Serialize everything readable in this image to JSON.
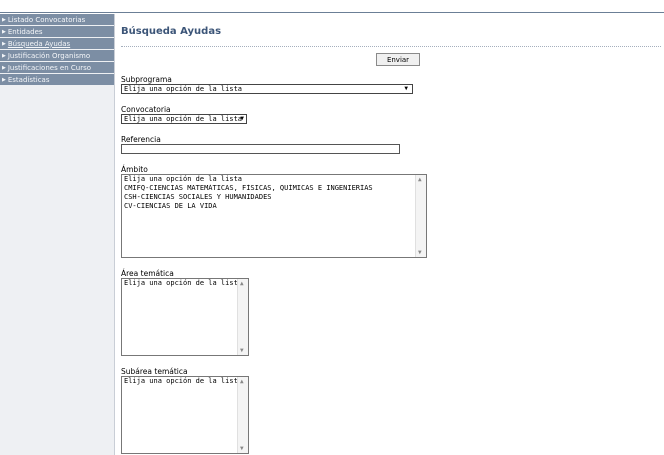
{
  "sidebar": {
    "items": [
      {
        "label": "Listado Convocatorias"
      },
      {
        "label": "Entidades"
      },
      {
        "label": "Búsqueda Ayudas"
      },
      {
        "label": "Justificación Organismo"
      },
      {
        "label": "Justificaciones en Curso"
      },
      {
        "label": "Estadísticas"
      }
    ]
  },
  "page": {
    "title": "Búsqueda Ayudas",
    "send_label": "Enviar"
  },
  "form": {
    "subprograma": {
      "label": "Subprograma",
      "value": "Elija una opción de la lista"
    },
    "convocatoria": {
      "label": "Convocatoria",
      "value": "Elija una opción de la lista"
    },
    "referencia": {
      "label": "Referencia",
      "value": ""
    },
    "ambito": {
      "label": "Ámbito",
      "options": [
        "Elija una opción de la lista",
        "CMIFQ-CIENCIAS MATEMÁTICAS, FÍSICAS, QUÍMICAS E INGENIERÍAS",
        "CSH-CIENCIAS SOCIALES Y HUMANIDADES",
        "CV-CIENCIAS DE LA VIDA"
      ]
    },
    "area_tematica": {
      "label": "Área temática",
      "options": [
        "Elija una opción de la lista"
      ]
    },
    "subarea_tematica": {
      "label": "Subárea temática",
      "options": [
        "Elija una opción de la lista"
      ]
    }
  },
  "icons": {
    "nav_arrow": "triangle-right-icon",
    "dropdown": "triangle-down-icon",
    "scroll_up": "triangle-up-icon",
    "scroll_down": "triangle-down-icon"
  }
}
